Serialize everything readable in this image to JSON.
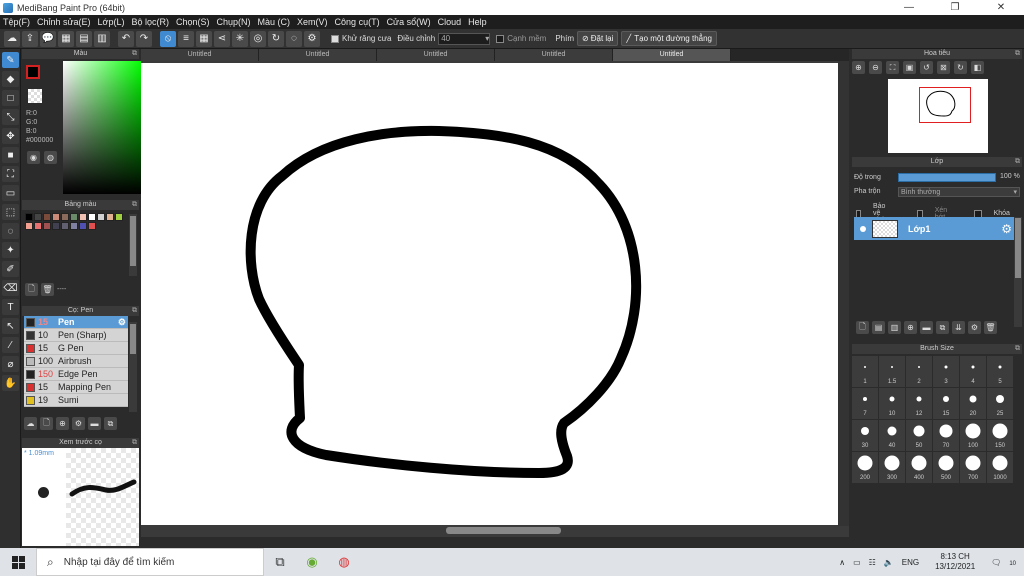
{
  "window": {
    "title": "MediBang Paint Pro (64bit)",
    "minimize": "—",
    "maximize": "❐",
    "close": "✕"
  },
  "menu": [
    "Tệp(F)",
    "Chỉnh sửa(E)",
    "Lớp(L)",
    "Bộ lọc(R)",
    "Chọn(S)",
    "Chụp(N)",
    "Màu (C)",
    "Xem(V)",
    "Công cụ(T)",
    "Cửa sổ(W)",
    "Cloud",
    "Help"
  ],
  "toolbar": {
    "antialias_label": "Khử răng cưa",
    "adjust_label": "Điều chỉnh",
    "adjust_value": "40",
    "edge_label": "Cạnh mềm",
    "key_label": "Phím",
    "reset_label": "Đặt lại",
    "straight_line_label": "Tạo một đường thẳng"
  },
  "color_panel": {
    "title": "Màu",
    "r": "R:0",
    "g": "G:0",
    "b": "B:0",
    "hex": "#000000",
    "accent": "#3f8ad1"
  },
  "palette_panel": {
    "title": "Bảng màu",
    "colors": [
      "#000000",
      "#444444",
      "#7a4a3a",
      "#c98a7a",
      "#8a6a5a",
      "#6a8a6a",
      "#f0c0b0",
      "#ffffff",
      "#d0d0d0",
      "#e0b090",
      "#a0d040",
      "#f4a090",
      "#e87070",
      "#a05050",
      "#404050",
      "#606070",
      "#8080a0",
      "#5050b0",
      "#e05050"
    ],
    "footer_text": "----"
  },
  "brush_panel": {
    "title": "Cọ: Pen",
    "items": [
      {
        "size": "15",
        "name": "Pen",
        "color": "#222222"
      },
      {
        "size": "10",
        "name": "Pen (Sharp)",
        "color": "#333333"
      },
      {
        "size": "15",
        "name": "G Pen",
        "color": "#d93030"
      },
      {
        "size": "100",
        "name": "Airbrush",
        "color": "#bbbbbb"
      },
      {
        "size": "150",
        "name": "Edge Pen",
        "color": "#222222"
      },
      {
        "size": "15",
        "name": "Mapping Pen",
        "color": "#d93030"
      },
      {
        "size": "19",
        "name": "Sumi",
        "color": "#e0c020"
      }
    ]
  },
  "preview_panel": {
    "title": "Xem trước cọ",
    "size": "1.09mm"
  },
  "tabs": [
    "Untitled",
    "Untitled",
    "Untitled",
    "Untitled",
    "Untitled"
  ],
  "navigator": {
    "title": "Hoa tiêu"
  },
  "layer_panel": {
    "title": "Lớp",
    "opacity_label": "Độ trong",
    "opacity_value": "100 %",
    "opacity": 1.0,
    "blend_label": "Pha trộn",
    "blend_value": "Bình thường",
    "protect_alpha": "Bảo vệ alpha",
    "clip": "Xén bớt",
    "lock": "Khóa",
    "layer_name": "Lớp1"
  },
  "brush_size_panel": {
    "title": "Brush Size",
    "sizes": [
      "1",
      "1.5",
      "2",
      "3",
      "4",
      "5",
      "7",
      "10",
      "12",
      "15",
      "20",
      "25",
      "30",
      "40",
      "50",
      "70",
      "100",
      "150",
      "200",
      "300",
      "400",
      "500",
      "700",
      "1000"
    ]
  },
  "taskbar": {
    "search_placeholder": "Nhập tại đây để tìm kiếm",
    "lang": "ENG",
    "time": "8:13 CH",
    "date": "13/12/2021",
    "notifications": "10"
  }
}
